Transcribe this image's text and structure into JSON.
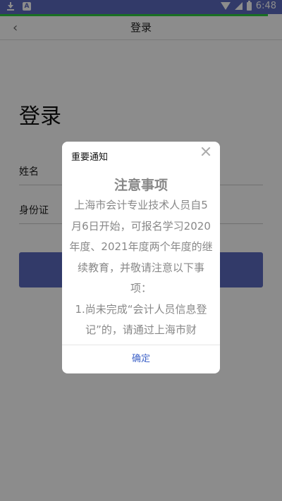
{
  "status_bar": {
    "time": "6:48",
    "icons": [
      "download-icon",
      "app-a-icon",
      "wifi-icon",
      "signal-icon",
      "battery-icon"
    ],
    "color": "#5c6bc0"
  },
  "nav": {
    "back_glyph": "‹",
    "title": "登录"
  },
  "login": {
    "heading": "登录",
    "name_label": "姓名",
    "id_label": "身份证",
    "button_color": "#5c6bc0"
  },
  "dialog": {
    "title": "重要通知",
    "notice_heading": "注意事项",
    "notice_text": "上海市会计专业技术人员自5月6日开始，可报名学习2020年度、2021年度两个年度的继续教育，并敬请注意以下事项：",
    "notice_item_1": "1.尚未完成“会计人员信息登记”的，请通过上海市财",
    "confirm_label": "确定",
    "confirm_color": "#3f63c8"
  }
}
